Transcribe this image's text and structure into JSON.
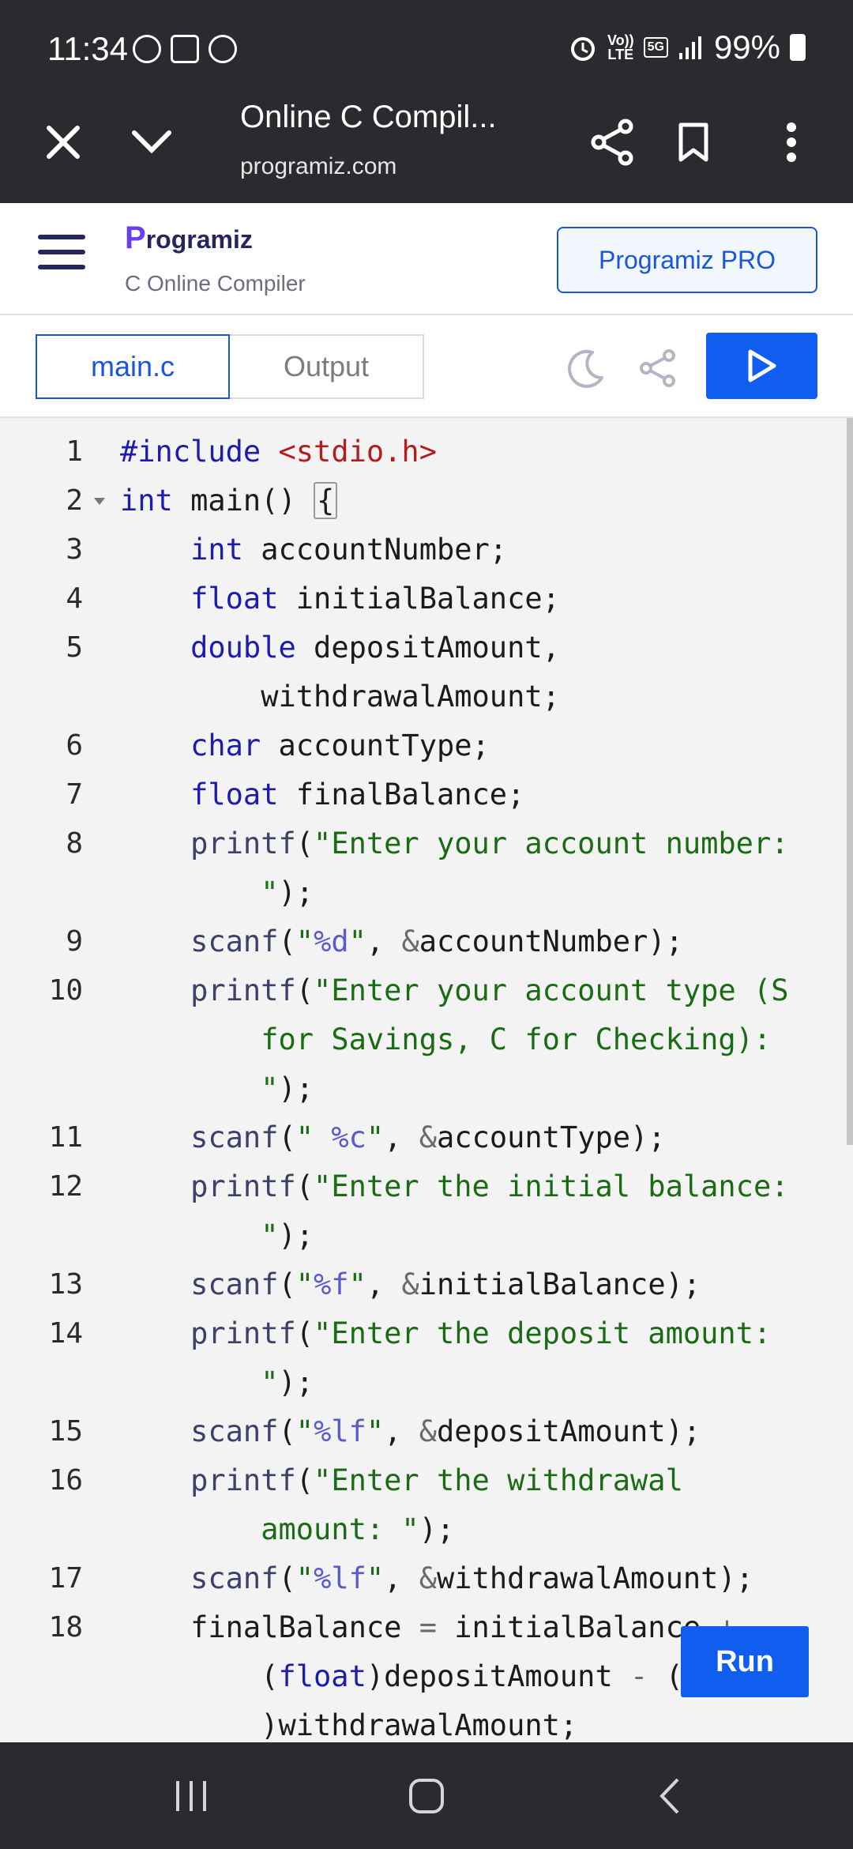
{
  "status": {
    "time": "11:34",
    "volte_top": "Vo))",
    "volte_bottom": "LTE",
    "network": "5G",
    "battery": "99%"
  },
  "browser": {
    "title": "Online C Compil...",
    "url": "programiz.com"
  },
  "header": {
    "logo_first": "P",
    "logo_rest": "rogramiz",
    "subtitle": "C Online Compiler",
    "pro_button": "Programiz PRO"
  },
  "tabs": {
    "main": "main.c",
    "output": "Output"
  },
  "run_button": "Run",
  "code": {
    "line_numbers": [
      "1",
      "2",
      "3",
      "4",
      "5",
      "6",
      "7",
      "8",
      "9",
      "10",
      "11",
      "12",
      "13",
      "14",
      "15",
      "16",
      "17",
      "18"
    ]
  }
}
